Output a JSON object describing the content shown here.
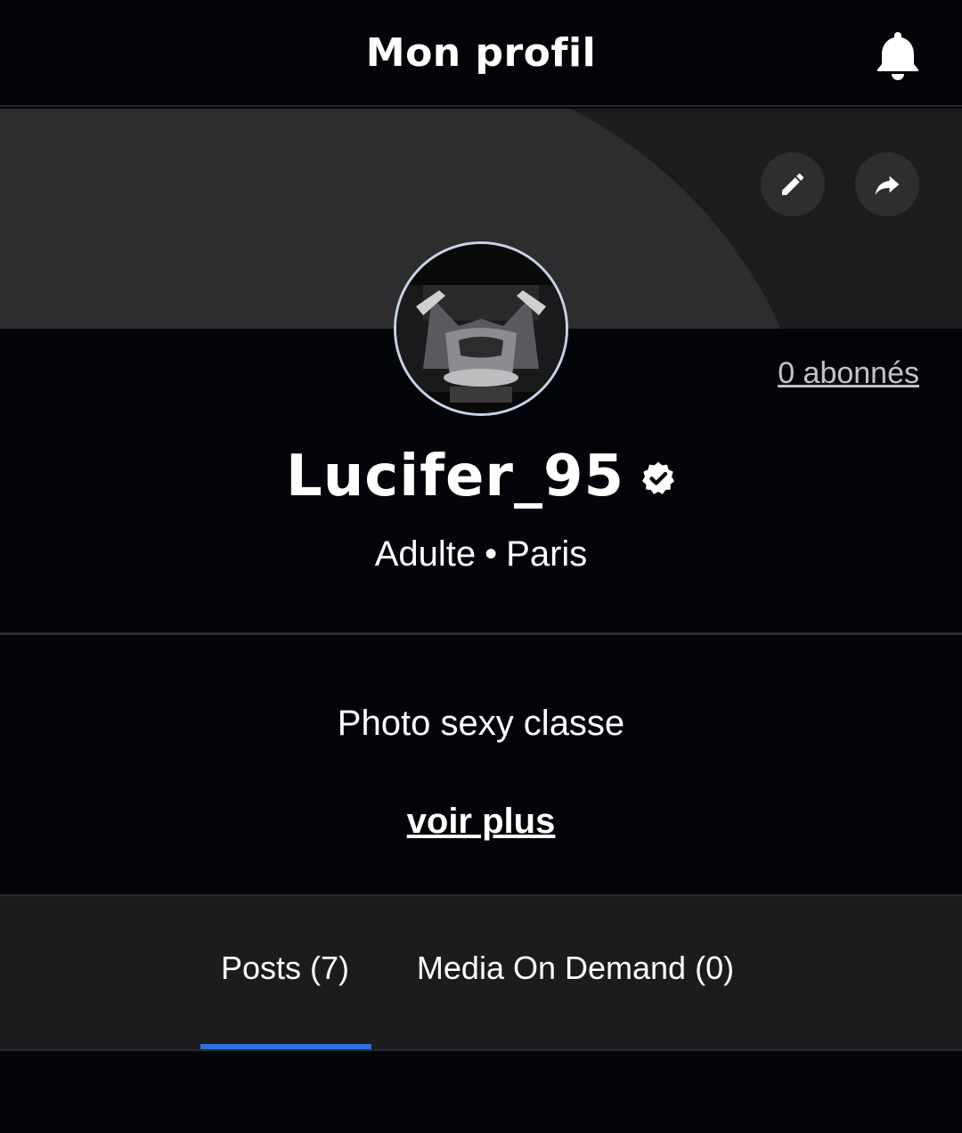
{
  "header": {
    "title": "Mon profil",
    "notification_icon": "bell-icon"
  },
  "banner": {
    "edit_icon": "pencil-icon",
    "share_icon": "share-arrow-icon"
  },
  "profile": {
    "followers_label": "0 abonnés",
    "username": "Lucifer_95",
    "verified_icon": "verified-badge-icon",
    "category": "Adulte",
    "separator": "•",
    "city": "Paris",
    "bio": "Photo sexy classe",
    "see_more_label": "voir plus"
  },
  "tabs": [
    {
      "label": "Posts (7)",
      "active": true
    },
    {
      "label": "Media On Demand (0)",
      "active": false
    }
  ],
  "colors": {
    "background": "#04050b",
    "banner": "#1d1d1f",
    "banner_arc": "#2d2d2f",
    "tab_bar": "#1c1c1e",
    "accent": "#2f6fdc",
    "avatar_ring": "#c9d3ea"
  }
}
